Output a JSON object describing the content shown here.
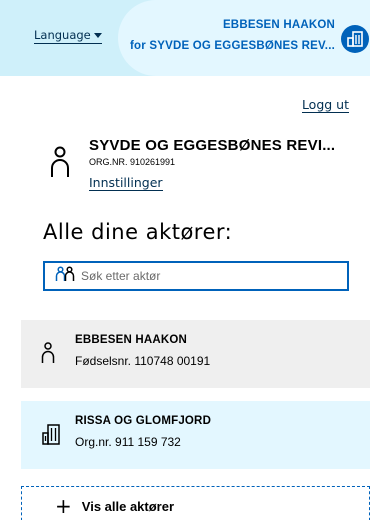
{
  "header": {
    "language_label": "Language",
    "profile_name": "EBBESEN HAAKON",
    "profile_org": "for SYVDE OG EGGESBØNES REV...",
    "avatar_icon": "building-icon",
    "bg_color": "#cff0fa",
    "accent_color": "#0062ba"
  },
  "logout_label": "Logg ut",
  "selected_actor": {
    "icon": "person-icon",
    "name": "SYVDE OG EGGESBØNES REVI...",
    "org_number": "ORG.NR. 910261991",
    "settings_label": "Innstillinger"
  },
  "heading": "Alle dine aktører:",
  "search": {
    "icon": "people-icon",
    "placeholder": "Søk etter aktør",
    "value": ""
  },
  "actors": [
    {
      "icon": "person-icon",
      "name": "EBBESEN HAAKON",
      "sub": "Fødselsnr. 110748 00191",
      "bg": "#efefef"
    },
    {
      "icon": "building-icon",
      "name": "RISSA OG GLOMFJORD",
      "sub": "Org.nr. 911 159 732",
      "bg": "#e3f7ff"
    }
  ],
  "show_all": {
    "icon": "plus-icon",
    "label": "Vis alle aktører"
  }
}
